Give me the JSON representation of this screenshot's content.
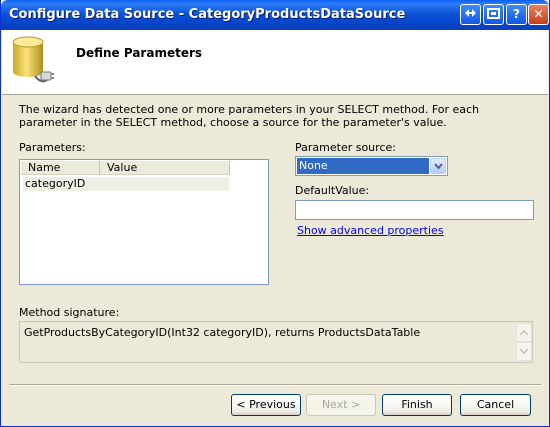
{
  "window": {
    "title": "Configure Data Source - CategoryProductsDataSource",
    "title_buttons": [
      "back-forward-icon",
      "restore-icon",
      "help-icon",
      "close-icon"
    ]
  },
  "header": {
    "title": "Define Parameters",
    "icon": "database-plug-icon"
  },
  "description": "The wizard has detected one or more parameters in your SELECT method. For each parameter in the SELECT method, choose a source for the parameter's value.",
  "parameters": {
    "label": "Parameters:",
    "columns": [
      "Name",
      "Value"
    ],
    "rows": [
      {
        "name": "categoryID",
        "value": ""
      }
    ]
  },
  "parameter_source": {
    "label": "Parameter source:",
    "selected": "None"
  },
  "default_value": {
    "label": "DefaultValue:",
    "value": ""
  },
  "advanced_link": "Show advanced properties",
  "method_signature": {
    "label": "Method signature:",
    "text": "GetProductsByCategoryID(Int32 categoryID), returns ProductsDataTable"
  },
  "buttons": {
    "previous": "< Previous",
    "next": "Next >",
    "finish": "Finish",
    "cancel": "Cancel"
  },
  "colors": {
    "title_bar": "#0b53d8",
    "selection": "#316ac5",
    "link": "#0000ff",
    "dialog_bg": "#ece9d8"
  }
}
